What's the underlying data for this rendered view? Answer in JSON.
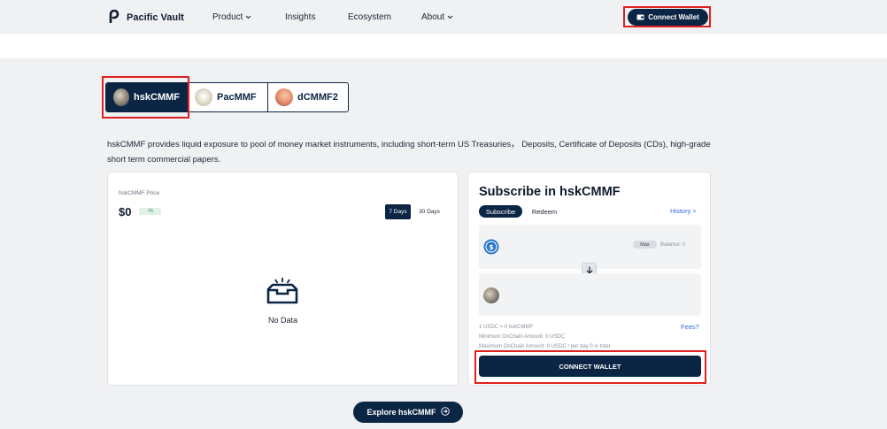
{
  "nav": {
    "brand": "Pacific Vault",
    "items": [
      "Product",
      "Insights",
      "Ecosystem",
      "About"
    ],
    "connect": "Connect Wallet"
  },
  "tabs": [
    {
      "label": "hskCMMF",
      "active": true
    },
    {
      "label": "PacMMF",
      "active": false
    },
    {
      "label": "dCMMF2",
      "active": false
    }
  ],
  "description": "hskCMMF provides liquid exposure to pool of money market instruments, including short-term US Treasuries， Deposits, Certificate of Deposits (CDs), high-grade short term commercial papers.",
  "price_card": {
    "label": "hskCMMF Price",
    "value": "$0",
    "change": "-%",
    "ranges": [
      "7 Days",
      "30 Days"
    ],
    "active_range": "7 Days",
    "empty_text": "No Data"
  },
  "subscribe": {
    "title": "Subscribe in hskCMMF",
    "tabs": [
      "Subscribe",
      "Redeem"
    ],
    "active_tab": "Subscribe",
    "history": "History >",
    "max": "Max",
    "balance": "Balance: 0",
    "rate": "1 USDC = 0 hskCMMF",
    "min_amount": "Minimum OnChain Amount: 0 USDC",
    "max_amount": "Maximum OnChain Amount: 0 USDC / per day 0 in total",
    "fees": "Fees?",
    "connect": "CONNECT WALLET"
  },
  "explore": "Explore hskCMMF",
  "colors": {
    "navy": "#0b2545",
    "highlight": "#e0201f",
    "link": "#2f6ad9",
    "positive_bg": "#e1f2e8"
  },
  "icons": {
    "logo": "pacific-vault-logo",
    "wallet": "wallet-icon",
    "usdc": "usdc-icon",
    "swap": "arrow-down-icon",
    "empty": "empty-tray-icon",
    "explore": "arrow-right-circle-icon"
  }
}
